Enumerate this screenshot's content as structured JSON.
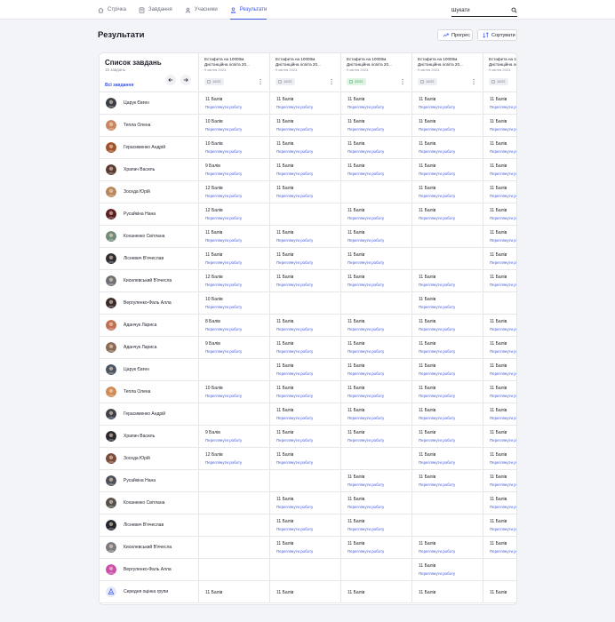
{
  "nav": {
    "items": [
      {
        "label": "Стрічка",
        "icon": "home-icon",
        "active": false
      },
      {
        "label": "Завдання",
        "icon": "tasks-icon",
        "active": false
      },
      {
        "label": "Учасники",
        "icon": "users-icon",
        "active": false
      },
      {
        "label": "Результати",
        "icon": "user-icon",
        "active": true
      }
    ]
  },
  "search": {
    "placeholder": "Шукати"
  },
  "page": {
    "title": "Результати"
  },
  "toolbar": {
    "progress_label": "Прогрес",
    "sort_label": "Сортувати"
  },
  "list": {
    "title": "Список завдань",
    "count": "15 завдань",
    "all_tasks": "Всі завдання"
  },
  "review_label": "Переглянути роботу",
  "colors": {
    "accent": "#3e56e6",
    "done_badge_bg": "#dff4e4",
    "done_badge_text": "#2b9a4d"
  },
  "columns": [
    {
      "title": "Естафета на 10000м. Дистанційна освіта 20...",
      "date": "9 квітня 2023",
      "badge": "12/22",
      "done": false
    },
    {
      "title": "Естафета на 10000м. Дистанційна освіта 20...",
      "date": "9 квітня 2023",
      "badge": "12/22",
      "done": false
    },
    {
      "title": "Естафета на 10000м. Дистанційна освіта 20...",
      "date": "9 квітня 2023",
      "badge": "22/22",
      "done": true
    },
    {
      "title": "Естафета на 10000м. Дистанційна освіта 20...",
      "date": "9 квітня 2023",
      "badge": "12/22",
      "done": false
    },
    {
      "title": "Естафета на 10000м. Дистанційна освіта 20...",
      "date": "9 квітня 2023",
      "badge": "12/22",
      "done": false
    }
  ],
  "rows": [
    {
      "name": "Царук Євген",
      "avatar": "#3b3d45",
      "scores": [
        "11 Балів",
        "11 Балів",
        "11 Балів",
        "11 Балів",
        "11 Балів"
      ]
    },
    {
      "name": "Тепла Олена",
      "avatar": "#c9855f",
      "scores": [
        "10 Балів",
        "11 Балів",
        "11 Балів",
        "11 Балів",
        "11 Балів"
      ]
    },
    {
      "name": "Герасименко Андрій",
      "avatar": "#a0522d",
      "scores": [
        "10 Балів",
        "11 Балів",
        "11 Балів",
        "11 Балів",
        "11 Балів"
      ]
    },
    {
      "name": "Храпач Василь",
      "avatar": "#5a3a30",
      "scores": [
        "9 Балів",
        "11 Балів",
        "11 Балів",
        "11 Балів",
        "11 Балів"
      ]
    },
    {
      "name": "Зоседа Юрій",
      "avatar": "#b8865b",
      "scores": [
        "12 Балів",
        "11 Балів",
        "",
        "11 Балів",
        "11 Балів"
      ]
    },
    {
      "name": "Русайкіна Нана",
      "avatar": "#5b1f1f",
      "scores": [
        "12 Балів",
        "",
        "11 Балів",
        "11 Балів",
        "11 Балів"
      ]
    },
    {
      "name": "Коханенко Світлана",
      "avatar": "#6f8a7a",
      "scores": [
        "11 Балів",
        "11 Балів",
        "11 Балів",
        "",
        "11 Балів"
      ]
    },
    {
      "name": "Лісневич В'ячеслав",
      "avatar": "#2e2e32",
      "scores": [
        "11 Балів",
        "11 Балів",
        "11 Балів",
        "",
        "11 Балів"
      ]
    },
    {
      "name": "Кисилевський В'ячесла",
      "avatar": "#6e6f73",
      "scores": [
        "12 Балів",
        "11 Балів",
        "11 Балів",
        "11 Балів",
        "11 Балів"
      ]
    },
    {
      "name": "Вергуленко-Фаль Алла",
      "avatar": "#3a2a28",
      "scores": [
        "10 Балів",
        "",
        "",
        "11 Балів",
        ""
      ]
    },
    {
      "name": "Аданчук Лариса",
      "avatar": "#c07050",
      "scores": [
        "8 Балів",
        "11 Балів",
        "11 Балів",
        "11 Балів",
        "11 Балів"
      ]
    },
    {
      "name": "Аданчук Лариса",
      "avatar": "#8a6a55",
      "scores": [
        "9 Балів",
        "11 Балів",
        "11 Балів",
        "11 Балів",
        "11 Балів"
      ]
    },
    {
      "name": "Царук Євген",
      "avatar": "#4a5560",
      "scores": [
        "",
        "11 Балів",
        "11 Балів",
        "11 Балів",
        "11 Балів"
      ]
    },
    {
      "name": "Тепла Олена",
      "avatar": "#d08a55",
      "scores": [
        "10 Балів",
        "11 Балів",
        "11 Балів",
        "11 Балів",
        "11 Балів"
      ]
    },
    {
      "name": "Герасименко Андрій",
      "avatar": "#3c4048",
      "scores": [
        "",
        "11 Балів",
        "11 Балів",
        "11 Балів",
        "11 Балів"
      ]
    },
    {
      "name": "Храпач Василь",
      "avatar": "#2a2a2e",
      "scores": [
        "9 Балів",
        "11 Балів",
        "11 Балів",
        "11 Балів",
        "11 Балів"
      ]
    },
    {
      "name": "Зоседа Юрій",
      "avatar": "#7a4a3a",
      "scores": [
        "12 Балів",
        "11 Балів",
        "",
        "11 Балів",
        "11 Балів"
      ]
    },
    {
      "name": "Русайкіна Нана",
      "avatar": "#4d5058",
      "scores": [
        "",
        "",
        "11 Балів",
        "11 Балів",
        "11 Балів"
      ]
    },
    {
      "name": "Коханенко Світлана",
      "avatar": "#55504a",
      "scores": [
        "",
        "11 Балів",
        "11 Балів",
        "",
        "11 Балів"
      ]
    },
    {
      "name": "Лісневич В'ячеслав",
      "avatar": "#22252b",
      "scores": [
        "",
        "11 Балів",
        "11 Балів",
        "",
        "11 Балів"
      ]
    },
    {
      "name": "Кисилевський В'ячесла",
      "avatar": "#7a7c80",
      "scores": [
        "",
        "11 Балів",
        "11 Балів",
        "11 Балів",
        "11 Балів"
      ]
    },
    {
      "name": "Вергуленко-Фаль Алла",
      "avatar": "#c94fa8",
      "scores": [
        "",
        "",
        "",
        "11 Балів",
        ""
      ]
    }
  ],
  "average": {
    "label": "Середня оцінка групи",
    "scores": [
      "11 Балів",
      "11 Балів",
      "11 Балів",
      "11 Балів",
      "11 Балів"
    ]
  }
}
